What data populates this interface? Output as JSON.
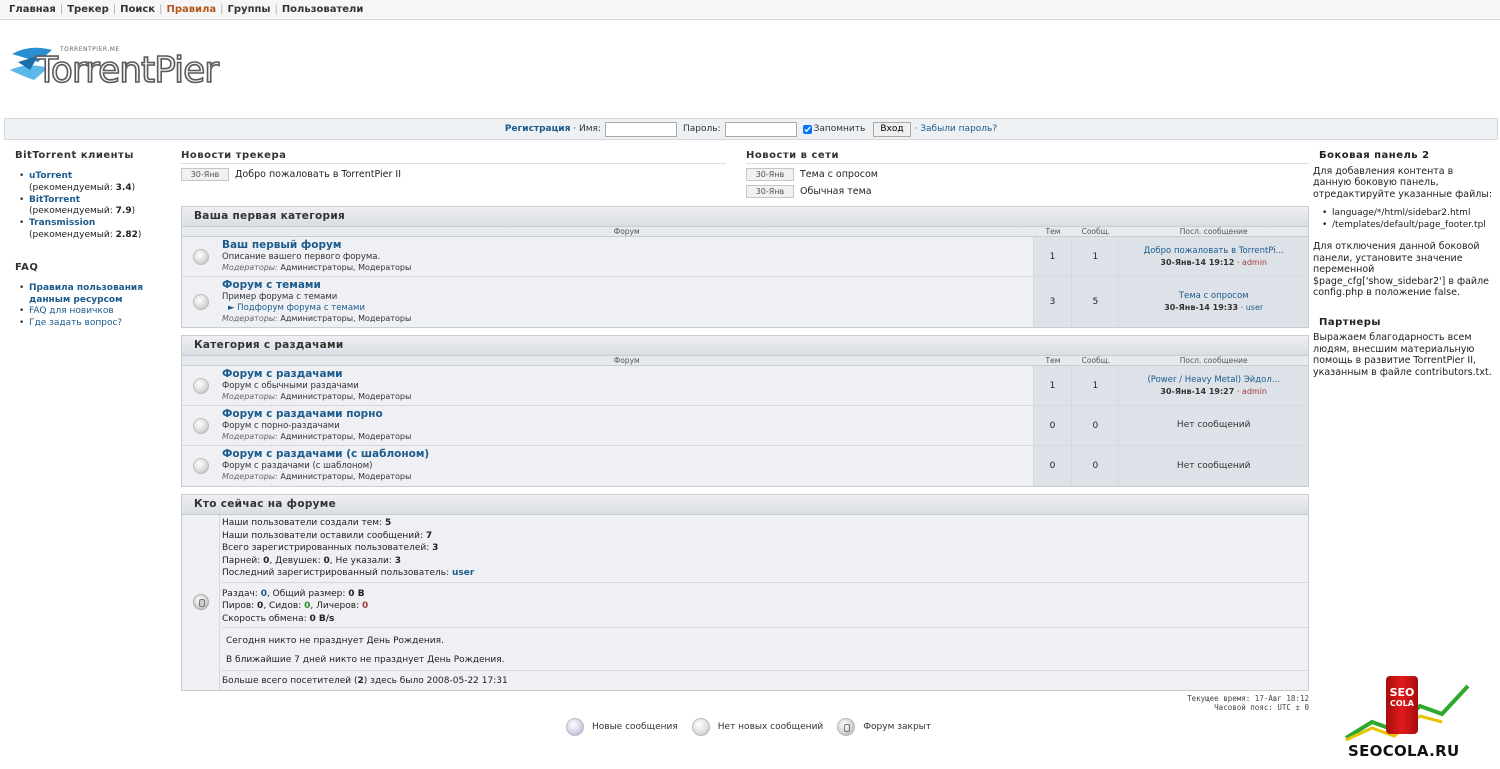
{
  "topmenu": {
    "items": [
      "Главная",
      "Трекер",
      "Поиск",
      "Правила",
      "Группы",
      "Пользователи"
    ],
    "active": "Правила"
  },
  "logo": {
    "small": "TORRENTPIER.ME",
    "big": "TorrentPier"
  },
  "login": {
    "register": "Регистрация",
    "name_label": "· Имя:",
    "password_label": "Пароль:",
    "remember_label": "Запомнить",
    "submit": "Вход",
    "forgot": "· Забыли пароль?"
  },
  "left": {
    "clients_title": "BitTorrent клиенты",
    "clients": [
      {
        "name": "uTorrent",
        "note": "(рекомендуемый: ",
        "ver": "3.4",
        "close": ")"
      },
      {
        "name": "BitTorrent",
        "note": "(рекомендуемый: ",
        "ver": "7.9",
        "close": ")"
      },
      {
        "name": "Transmission",
        "note": "(рекомендуемый: ",
        "ver": "2.82",
        "close": ")"
      }
    ],
    "faq_title": "FAQ",
    "faq": [
      "Правила пользования данным ресурсом",
      "FAQ для новичков",
      "Где задать вопрос?"
    ]
  },
  "news_tracker": {
    "title": "Новости трекера",
    "items": [
      {
        "date": "30-Янв",
        "text": "Добро пожаловать в TorrentPier II"
      }
    ]
  },
  "news_net": {
    "title": "Новости в сети",
    "items": [
      {
        "date": "30-Янв",
        "text": "Тема с опросом"
      },
      {
        "date": "30-Янв",
        "text": "Обычная тема"
      }
    ]
  },
  "columns": {
    "forum": "Форум",
    "topics": "Тем",
    "posts": "Сообщ.",
    "last": "Посл. сообщение"
  },
  "categories": [
    {
      "title": "Ваша первая категория",
      "forums": [
        {
          "name": "Ваш первый форум",
          "desc": "Описание вашего первого форума.",
          "mods_label": "Модераторы:",
          "mods": "Администраторы, Модераторы",
          "topics": "1",
          "posts": "1",
          "last_title": "Добро пожаловать в TorrentPi...",
          "last_date": "30-Янв-14 19:12",
          "last_user": "admin"
        },
        {
          "name": "Форум с темами",
          "desc": "Пример форума с темами",
          "sub": "► Подфорум форума с темами",
          "mods_label": "Модераторы:",
          "mods": "Администраторы, Модераторы",
          "topics": "3",
          "posts": "5",
          "last_title": "Тема с опросом",
          "last_date": "30-Янв-14 19:33",
          "last_user": "user"
        }
      ]
    },
    {
      "title": "Категория с раздачами",
      "forums": [
        {
          "name": "Форум с раздачами",
          "desc": "Форум с обычными раздачами",
          "mods_label": "Модераторы:",
          "mods": "Администраторы, Модераторы",
          "topics": "1",
          "posts": "1",
          "last_title": "(Power / Heavy Metal) Эйдол...",
          "last_date": "30-Янв-14 19:27",
          "last_user": "admin"
        },
        {
          "name": "Форум с раздачами порно",
          "desc": "Форум с порно-раздачами",
          "mods_label": "Модераторы:",
          "mods": "Администраторы, Модераторы",
          "topics": "0",
          "posts": "0",
          "no_posts": "Нет сообщений"
        },
        {
          "name": "Форум с раздачами (с шаблоном)",
          "desc": "Форум с раздачами (с шаблоном)",
          "mods_label": "Модераторы:",
          "mods": "Администраторы, Модераторы",
          "topics": "0",
          "posts": "0",
          "no_posts": "Нет сообщений"
        }
      ]
    }
  ],
  "who": {
    "title": "Кто сейчас на форуме",
    "topics_label": "Наши пользователи создали тем: ",
    "topics": "5",
    "posts_label": "Наши пользователи оставили сообщений: ",
    "posts": "7",
    "users_label": "Всего зарегистрированных пользователей: ",
    "users": "3",
    "male_label": "Парней: ",
    "male": "0",
    "female_label": ", Девушек: ",
    "female": "0",
    "unknown_label": ", Не указали: ",
    "unknown": "3",
    "last_user_label": "Последний зарегистрированный пользователь: ",
    "last_user": "user",
    "releases_label": "Раздач: ",
    "releases": "0",
    "size_label": ",  Общий размер: ",
    "size": "0 B",
    "peers_label": "Пиров: ",
    "peers": "0",
    "seeds_label": ",  Сидов: ",
    "seeds": "0",
    "leech_label": ",  Личеров: ",
    "leech": "0",
    "speed_label": "Скорость обмена: ",
    "speed": "0 B/s",
    "bday_today": "Сегодня никто не празднует День Рождения.",
    "bday_week": "В ближайшие 7 дней никто не празднует День Рождения.",
    "record_label": "Больше всего посетителей (",
    "record_count": "2",
    "record_rest": ") здесь было 2008-05-22 17:31"
  },
  "time": {
    "current": "Текущее время: 17-Авг 18:12",
    "zone": "Часовой пояс: UTC ± 0"
  },
  "legend": {
    "new": "Новые сообщения",
    "nonew": "Нет новых сообщений",
    "locked": "Форум закрыт"
  },
  "sidebar2": {
    "title": "Боковая панель 2",
    "intro": "Для добавления контента в данную боковую панель, отредактируйте указанные файлы:",
    "files": [
      "language/*/html/sidebar2.html",
      "/templates/default/page_footer.tpl"
    ],
    "disable": "Для отключения данной боковой панели, установите значение переменной $page_cfg['show_sidebar2'] в файле config.php в положение false."
  },
  "partners": {
    "title": "Партнеры",
    "text": "Выражаем благодарность всем людям, внесшим материальную помощь в развитие TorrentPier II, указанным в файле contributors.txt."
  },
  "watermark": {
    "can1": "SEO",
    "can2": "COLA",
    "text": "SEOCOLA.RU"
  },
  "colors": {
    "link": "#1b5b8d",
    "active_menu": "#b4571e",
    "admin": "#a23c3c"
  }
}
